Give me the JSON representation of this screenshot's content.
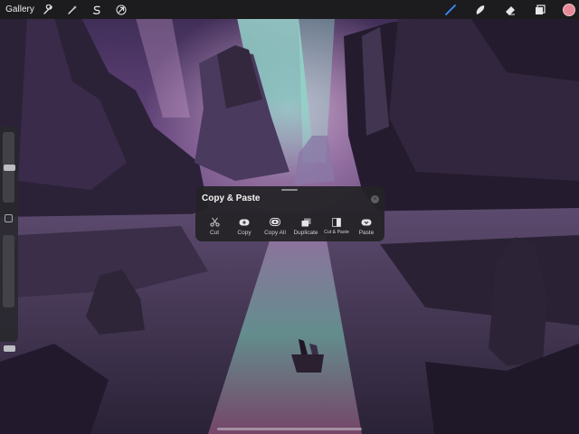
{
  "toolbar": {
    "gallery_label": "Gallery",
    "left_tools": [
      {
        "icon": "wrench-icon"
      },
      {
        "icon": "magic-wand-icon"
      },
      {
        "icon": "selection-s-icon"
      },
      {
        "icon": "transform-arrow-icon"
      }
    ],
    "right_tools": [
      {
        "icon": "brush-icon",
        "active": true,
        "accent": "#3d8cff"
      },
      {
        "icon": "smudge-icon"
      },
      {
        "icon": "eraser-icon"
      },
      {
        "icon": "layers-icon"
      }
    ],
    "current_color": "#e58a96"
  },
  "panel": {
    "title": "Copy & Paste",
    "actions": [
      {
        "label": "Cut",
        "icon": "scissors-icon"
      },
      {
        "label": "Copy",
        "icon": "copy-icon"
      },
      {
        "label": "Copy All",
        "icon": "copy-all-icon"
      },
      {
        "label": "Duplicate",
        "icon": "duplicate-icon"
      },
      {
        "label": "Cut & Paste",
        "icon": "cut-paste-icon"
      },
      {
        "label": "Paste",
        "icon": "paste-icon"
      }
    ]
  },
  "sidebar": {
    "brush_size_icon": "brush-size-slider",
    "opacity_icon": "opacity-slider",
    "modify_icon": "modify-square-icon"
  },
  "colors": {
    "toolbar_bg": "#1c1c1e",
    "panel_bg": "#242226",
    "accent": "#3d8cff",
    "aurora": "#6fe3c4"
  }
}
